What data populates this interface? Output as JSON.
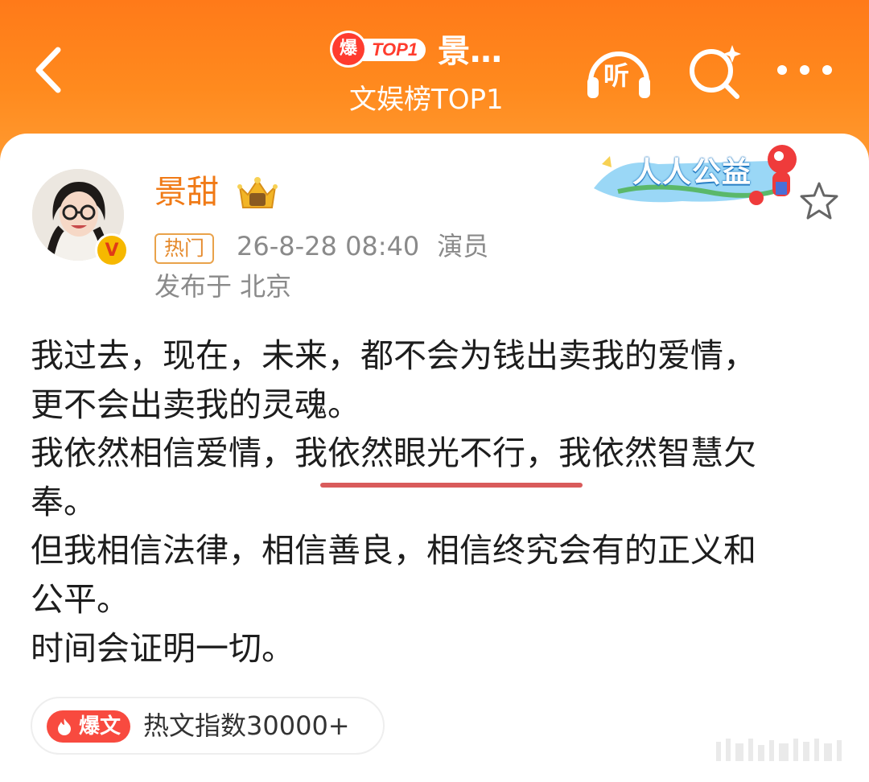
{
  "header": {
    "back_icon": "chevron-left-icon",
    "bao_badge": "爆",
    "top_badge": "TOP1",
    "title_truncated": "景…",
    "subtitle": "文娱榜TOP1",
    "listen_label": "听",
    "search_icon": "search-sparkle-icon",
    "more_icon": "more-dots-icon",
    "color": "#ff7a19"
  },
  "post": {
    "author": "景甜",
    "author_badge_icon": "crown-vip-icon",
    "verified_icon": "verified-v-icon",
    "hot_tag": "热门",
    "timestamp": "26-8-28 08:40",
    "role": "演员",
    "location": "发布于 北京",
    "charity_banner": "人人公益",
    "star_icon": "star-outline-icon",
    "lines": [
      "我过去，现在，未来，都不会为钱出卖我的爱情，",
      "更不会出卖我的灵魂。",
      "我依然相信爱情，我依然眼光不行，我依然智慧欠",
      "奉。",
      "但我相信法律，相信善良，相信终究会有的正义和",
      "公平。",
      "时间会证明一切。"
    ],
    "underlined_phrase": "我依然眼光不行",
    "underline_color": "#d95b5b",
    "name_color": "#f07a16"
  },
  "hot_index": {
    "badge_label": "爆文",
    "text": "热文指数30000+",
    "badge_color": "#f84a3f"
  }
}
